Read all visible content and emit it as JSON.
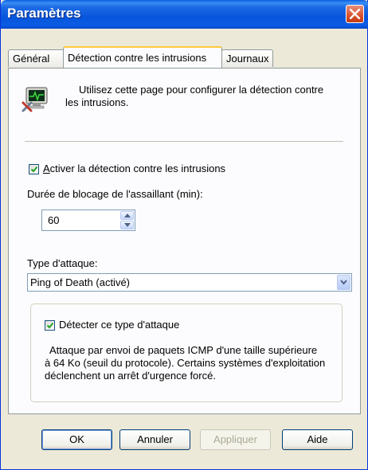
{
  "window": {
    "title": "Paramètres"
  },
  "tabs": [
    {
      "label": "Général"
    },
    {
      "label": "Détection contre les intrusions"
    },
    {
      "label": "Journaux"
    }
  ],
  "intro": {
    "line1": "Utilisez cette page pour configurer la détection contre",
    "line2": "les intrusions.",
    "icon": "network-monitor-tools-icon"
  },
  "enable": {
    "checked": true,
    "label_access": "A",
    "label_rest": "ctiver la détection contre les intrusions"
  },
  "duration": {
    "label": "Durée de blocage de l'assaillant (min):",
    "value": "60"
  },
  "attack_type": {
    "label": "Type d'attaque:",
    "selected": "Ping of Death (activé)"
  },
  "detect": {
    "checked": true,
    "label": "Détecter ce type d'attaque"
  },
  "description": {
    "line1": "Attaque par envoi de paquets ICMP d'une taille supérieure",
    "line2": "à 64 Ko (seuil du protocole). Certains systèmes d'exploitation",
    "line3": "déclenchent un arrêt d'urgence forcé."
  },
  "buttons": {
    "ok": "OK",
    "cancel": "Annuler",
    "apply": "Appliquer",
    "help": "Aide"
  },
  "colors": {
    "titlebar": "#0855DD",
    "close": "#D8522E",
    "active_tab_highlight": "#FFC83C",
    "check": "#21A121"
  }
}
